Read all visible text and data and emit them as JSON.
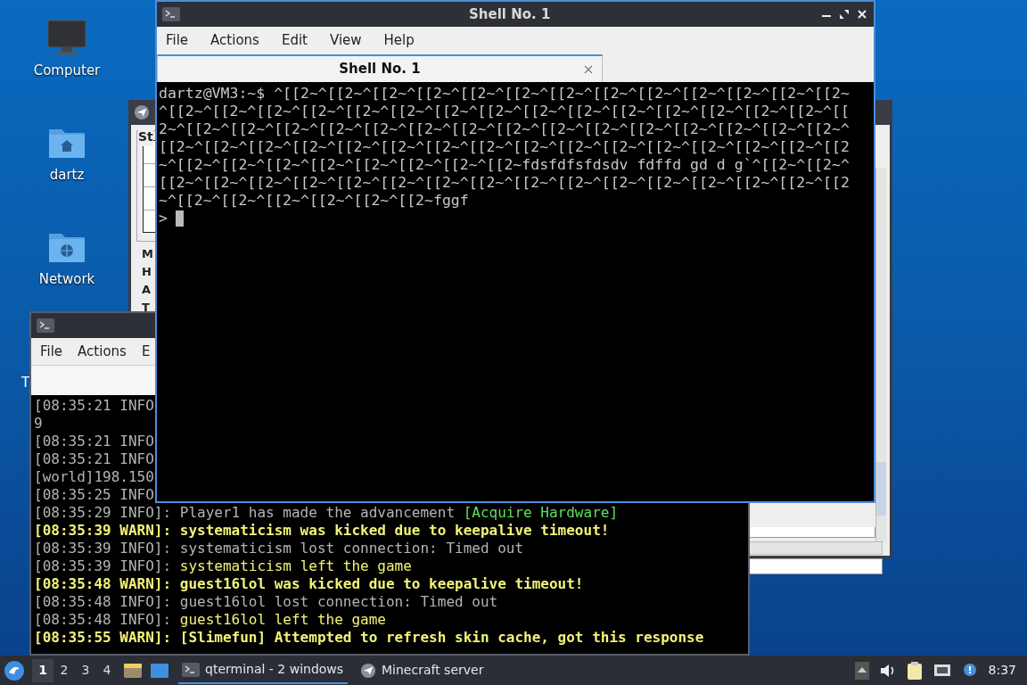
{
  "desktop": {
    "icons": [
      {
        "kind": "computer",
        "label": "Computer"
      },
      {
        "kind": "home",
        "label": "dartz"
      },
      {
        "kind": "network",
        "label": "Network"
      }
    ],
    "edge_label": "T"
  },
  "back_window": {
    "group_label": "St",
    "field_labels": [
      "M",
      "H",
      "A",
      "T"
    ]
  },
  "log_window": {
    "menu": [
      "File",
      "Actions",
      "E"
    ],
    "lines": [
      [
        {
          "kind": "info",
          "text": "[08:35:21 INFO"
        }
      ],
      [
        {
          "kind": "info",
          "text": "9"
        }
      ],
      [
        {
          "kind": "info",
          "text": "[08:35:21 INFO"
        }
      ],
      [
        {
          "kind": "info",
          "text": "[08:35:21 INFO"
        }
      ],
      [
        {
          "kind": "info",
          "text": "[world]198.150"
        }
      ],
      [
        {
          "kind": "info",
          "text": "[08:35:25 INFO"
        }
      ],
      [
        {
          "kind": "info",
          "text": "[08:35:29 INFO]: Player1 has made the advancement "
        },
        {
          "kind": "advancement",
          "text": "[Acquire Hardware]"
        }
      ],
      [
        {
          "kind": "warn",
          "text": "[08:35:39 WARN]: systematicism was kicked due to keepalive timeout!"
        }
      ],
      [
        {
          "kind": "info",
          "text": "[08:35:39 INFO]: systematicism lost connection: Timed out"
        }
      ],
      [
        {
          "kind": "info",
          "text": "[08:35:39 INFO]: "
        },
        {
          "kind": "player",
          "text": "systematicism left the game"
        }
      ],
      [
        {
          "kind": "warn",
          "text": "[08:35:48 WARN]: guest16lol was kicked due to keepalive timeout!"
        }
      ],
      [
        {
          "kind": "info",
          "text": "[08:35:48 INFO]: guest16lol lost connection: Timed out"
        }
      ],
      [
        {
          "kind": "info",
          "text": "[08:35:48 INFO]: "
        },
        {
          "kind": "player",
          "text": "guest16lol left the game"
        }
      ],
      [
        {
          "kind": "warn",
          "text": "[08:35:55 WARN]: [Slimefun] Attempted to refresh skin cache, got this response"
        }
      ]
    ]
  },
  "shell_window": {
    "title": "Shell No. 1",
    "menu": [
      "File",
      "Actions",
      "Edit",
      "View",
      "Help"
    ],
    "tabs": [
      {
        "label": "Shell No. 1",
        "selected": true
      }
    ],
    "lines": [
      "dartz@VM3:~$ ^[[2~^[[2~^[[2~^[[2~^[[2~^[[2~^[[2~^[[2~^[[2~^[[2~^[[2~^[[2~^[[2~",
      "^[[2~^[[2~^[[2~^[[2~^[[2~^[[2~^[[2~^[[2~^[[2~^[[2~^[[2~^[[2~^[[2~^[[2~^[[2~^[[",
      "2~^[[2~^[[2~^[[2~^[[2~^[[2~^[[2~^[[2~^[[2~^[[2~^[[2~^[[2~^[[2~^[[2~^[[2~^[[2~^",
      "[[2~^[[2~^[[2~^[[2~^[[2~^[[2~^[[2~^[[2~^[[2~^[[2~^[[2~^[[2~^[[2~^[[2~^[[2~^[[2",
      "~^[[2~^[[2~^[[2~^[[2~^[[2~^[[2~^[[2~^[[2~fdsfdfsfdsdv fdffd gd d g`^[[2~^[[2~^",
      "[[2~^[[2~^[[2~^[[2~^[[2~^[[2~^[[2~^[[2~^[[2~^[[2~^[[2~^[[2~^[[2~^[[2~^[[2~^[[2",
      "~^[[2~^[[2~^[[2~^[[2~^[[2~^[[2~fggf"
    ],
    "prompt": ">"
  },
  "taskbar": {
    "workspaces": [
      {
        "label": "1",
        "selected": true
      },
      {
        "label": "2",
        "selected": false
      },
      {
        "label": "3",
        "selected": false
      },
      {
        "label": "4",
        "selected": false
      }
    ],
    "tasks": [
      {
        "kind": "terminal",
        "label": "qterminal - 2 windows",
        "selected": true
      },
      {
        "kind": "minecraft",
        "label": "Minecraft server",
        "selected": false
      }
    ],
    "clock": "8:37"
  }
}
